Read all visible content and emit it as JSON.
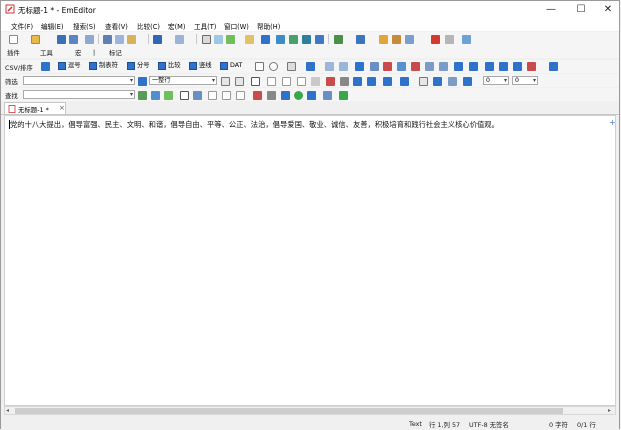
{
  "window": {
    "title": "无标题-1 * - EmEditor",
    "min": "—",
    "max": "☐",
    "close": "✕"
  },
  "menu": [
    "文件(F)",
    "编辑(E)",
    "搜索(S)",
    "查看(V)",
    "比较(C)",
    "宏(M)",
    "工具(T)",
    "窗口(W)",
    "帮助(H)"
  ],
  "toolbar3": {
    "plugins": "插件",
    "tools": "工具",
    "macro": "宏",
    "macro_sep": "|",
    "mark": "标记"
  },
  "csv": {
    "label": "CSV/排序",
    "buttons": [
      "逗号",
      "制表符",
      "分号",
      "比较",
      "竖线",
      "DAT"
    ],
    "combo_a": "0",
    "combo_b": "0"
  },
  "filter": {
    "label": "筛选",
    "value": "",
    "mode": "一整行"
  },
  "search": {
    "label": "查找",
    "value": ""
  },
  "tab": {
    "label": "无标题-1 *",
    "close": "×"
  },
  "editor": {
    "text": "党的十八大提出，倡导富强、民主、文明、和谐，倡导自由、平等、公正、法治，倡导爱国、敬业、诚信、友善，积极培育和践行社会主义核心价值观。",
    "plus": "+"
  },
  "status": {
    "mode": "Text",
    "position": "行 1,列 57",
    "encoding": "UTF-8 无签名",
    "chars": "0 字符",
    "lines": "0/1 行"
  },
  "colors": {
    "accent": "#2e72c9",
    "titlebar": "#ffffff",
    "toolbar": "#f5f5f5"
  }
}
